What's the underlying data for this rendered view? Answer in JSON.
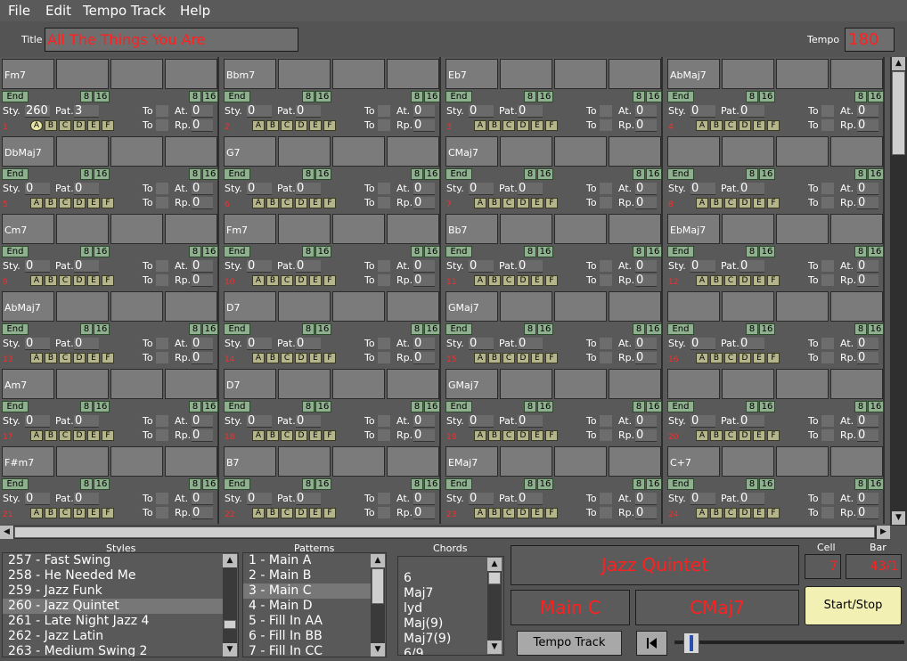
{
  "menu": [
    "File",
    "Edit",
    "Tempo Track",
    "Help"
  ],
  "header": {
    "title_label": "Title",
    "title_value": "All The Things You Are",
    "tempo_label": "Tempo",
    "tempo_value": "180"
  },
  "cell_labels": {
    "end": "End",
    "eight": "8",
    "sixteen": "16",
    "sty": "Sty.",
    "pat": "Pat.",
    "to": "To",
    "at": "At.",
    "rp": "Rp."
  },
  "pattern_letters": [
    "A",
    "B",
    "C",
    "D",
    "E",
    "F"
  ],
  "cells": [
    {
      "chord": "Fm7",
      "num": "1",
      "sty": "260",
      "pat": "3",
      "at": "0",
      "rp": "0",
      "active": "A"
    },
    {
      "chord": "Bbm7",
      "num": "2",
      "sty": "0",
      "pat": "0",
      "at": "0",
      "rp": "0"
    },
    {
      "chord": "Eb7",
      "num": "3",
      "sty": "0",
      "pat": "0",
      "at": "0",
      "rp": "0"
    },
    {
      "chord": "AbMaj7",
      "num": "4",
      "sty": "0",
      "pat": "0",
      "at": "0",
      "rp": "0"
    },
    {
      "chord": "DbMaj7",
      "num": "5",
      "sty": "0",
      "pat": "0",
      "at": "0",
      "rp": "0"
    },
    {
      "chord": "G7",
      "num": "6",
      "sty": "0",
      "pat": "0",
      "at": "0",
      "rp": "0"
    },
    {
      "chord": "CMaj7",
      "num": "7",
      "sty": "0",
      "pat": "0",
      "at": "0",
      "rp": "0"
    },
    {
      "chord": "",
      "num": "8",
      "sty": "0",
      "pat": "0",
      "at": "0",
      "rp": "0"
    },
    {
      "chord": "Cm7",
      "num": "9",
      "sty": "0",
      "pat": "0",
      "at": "0",
      "rp": "0"
    },
    {
      "chord": "Fm7",
      "num": "10",
      "sty": "0",
      "pat": "0",
      "at": "0",
      "rp": "0"
    },
    {
      "chord": "Bb7",
      "num": "11",
      "sty": "0",
      "pat": "0",
      "at": "0",
      "rp": "0"
    },
    {
      "chord": "EbMaj7",
      "num": "12",
      "sty": "0",
      "pat": "0",
      "at": "0",
      "rp": "0"
    },
    {
      "chord": "AbMaj7",
      "num": "13",
      "sty": "0",
      "pat": "0",
      "at": "0",
      "rp": "0"
    },
    {
      "chord": "D7",
      "num": "14",
      "sty": "0",
      "pat": "0",
      "at": "0",
      "rp": "0"
    },
    {
      "chord": "GMaj7",
      "num": "15",
      "sty": "0",
      "pat": "0",
      "at": "0",
      "rp": "0"
    },
    {
      "chord": "",
      "num": "16",
      "sty": "0",
      "pat": "0",
      "at": "0",
      "rp": "0"
    },
    {
      "chord": "Am7",
      "num": "17",
      "sty": "0",
      "pat": "0",
      "at": "0",
      "rp": "0"
    },
    {
      "chord": "D7",
      "num": "18",
      "sty": "0",
      "pat": "0",
      "at": "0",
      "rp": "0"
    },
    {
      "chord": "GMaj7",
      "num": "19",
      "sty": "0",
      "pat": "0",
      "at": "0",
      "rp": "0"
    },
    {
      "chord": "",
      "num": "20",
      "sty": "0",
      "pat": "0",
      "at": "0",
      "rp": "0"
    },
    {
      "chord": "F#m7",
      "num": "21",
      "sty": "0",
      "pat": "0",
      "at": "0",
      "rp": "0"
    },
    {
      "chord": "B7",
      "num": "22",
      "sty": "0",
      "pat": "0",
      "at": "0",
      "rp": "0"
    },
    {
      "chord": "EMaj7",
      "num": "23",
      "sty": "0",
      "pat": "0",
      "at": "0",
      "rp": "0"
    },
    {
      "chord": "C+7",
      "num": "24",
      "sty": "0",
      "pat": "0",
      "at": "0",
      "rp": "0"
    }
  ],
  "styles": {
    "title": "Styles",
    "items": [
      "257 - Fast Swing",
      "258 - He Needed Me",
      "259 - Jazz Funk",
      "260 - Jazz Quintet",
      "261 - Late Night Jazz 4",
      "262 - Jazz Latin",
      "263 - Medium Swing 2"
    ],
    "selected": 3
  },
  "patterns": {
    "title": "Patterns",
    "items": [
      "1 - Main A",
      "2 - Main B",
      "3 - Main C",
      "4 - Main D",
      "5 - Fill In AA",
      "6 - Fill In BB",
      "7 - Fill In CC"
    ],
    "selected": 2
  },
  "chords": {
    "title": "Chords",
    "items": [
      "6",
      "Maj7",
      "lyd",
      "Maj(9)",
      "Maj7(9)",
      "6/9"
    ]
  },
  "status": {
    "style_name": "Jazz Quintet",
    "pattern_name": "Main C",
    "chord_name": "CMaj7",
    "cell_label": "Cell",
    "cell_value": "7",
    "bar_label": "Bar",
    "bar_value": "43/1"
  },
  "buttons": {
    "tempo_track": "Tempo Track",
    "start_stop": "Start/Stop"
  },
  "colors": {
    "accent_red": "#ff2020",
    "end_green": "#8fb08f",
    "pattern_btn": "#b5b58c",
    "start_stop_bg": "#f3f0b4"
  }
}
